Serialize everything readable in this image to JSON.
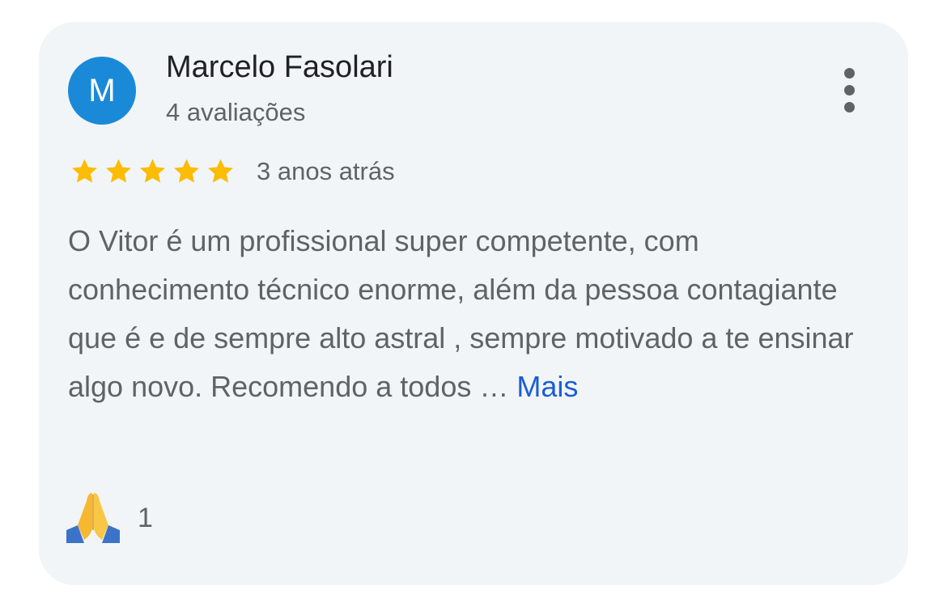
{
  "reviewer": {
    "initial": "M",
    "name": "Marcelo Fasolari",
    "review_count": "4 avaliações",
    "avatar_color": "#1a8ad8"
  },
  "rating": {
    "stars": 5,
    "max": 5,
    "star_color": "#fbbc04",
    "time_ago": "3 anos atrás"
  },
  "review": {
    "text": "O Vitor é um profissional super competente, com conhecimento técnico enorme, além da pessoa contagiante que é e de sempre alto astral , sempre motivado a te ensinar algo novo. Recomendo a todos",
    "ellipsis": " … ",
    "more_label": "Mais"
  },
  "reaction": {
    "icon": "folded-hands-icon",
    "count": "1"
  },
  "menu": {
    "icon": "more-vert-icon"
  }
}
